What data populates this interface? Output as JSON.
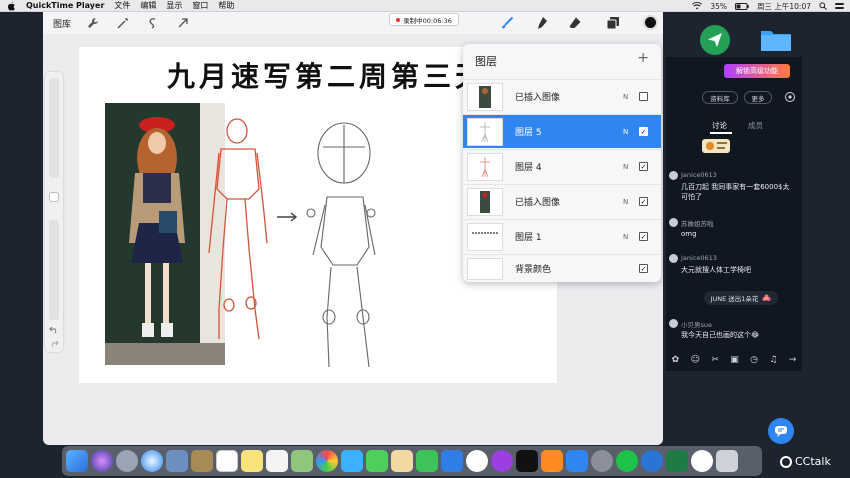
{
  "menubar": {
    "app_name": "QuickTime Player",
    "items": [
      "文件",
      "编辑",
      "显示",
      "窗口",
      "帮助"
    ],
    "battery": "35%",
    "datetime": "周三 上午10:07"
  },
  "procreate": {
    "gallery_label": "图库",
    "recording_badge": "录制中00:06:36",
    "canvas_title": "九月速写第二周第三天"
  },
  "layers": {
    "title": "图层",
    "add_symbol": "+",
    "rows": [
      {
        "name": "已插入图像",
        "mode": "N",
        "checked": false,
        "selected": false
      },
      {
        "name": "图层 5",
        "mode": "N",
        "checked": true,
        "selected": true
      },
      {
        "name": "图层 4",
        "mode": "N",
        "checked": true,
        "selected": false
      },
      {
        "name": "已插入图像",
        "mode": "N",
        "checked": true,
        "selected": false
      },
      {
        "name": "图层 1",
        "mode": "N",
        "checked": true,
        "selected": false
      },
      {
        "name": "背景颜色",
        "mode": "",
        "checked": true,
        "selected": false
      }
    ]
  },
  "chat": {
    "promo": "解锁高级功能",
    "pill_materials": "资料库",
    "pill_more": "更多",
    "tab_discuss": "讨论",
    "tab_members": "成员",
    "messages": [
      {
        "user": "Janice0613",
        "text": "几百刀起 我同事家有一套6000$太可怕了"
      },
      {
        "user": "苏姝姐苏啦",
        "text": "omg"
      },
      {
        "user": "Janice0613",
        "text": "大元就搜人体工学椅吧"
      },
      {
        "user": "小贝男sue",
        "text": "我今天自己也画的这个😂"
      }
    ],
    "system_notice": "JUNE 送出1朵花"
  },
  "brand": "CCtalk",
  "colors": {
    "accent_blue": "#2f86f0",
    "sketch_red": "#d2553a",
    "chat_bg": "#0f1821"
  }
}
